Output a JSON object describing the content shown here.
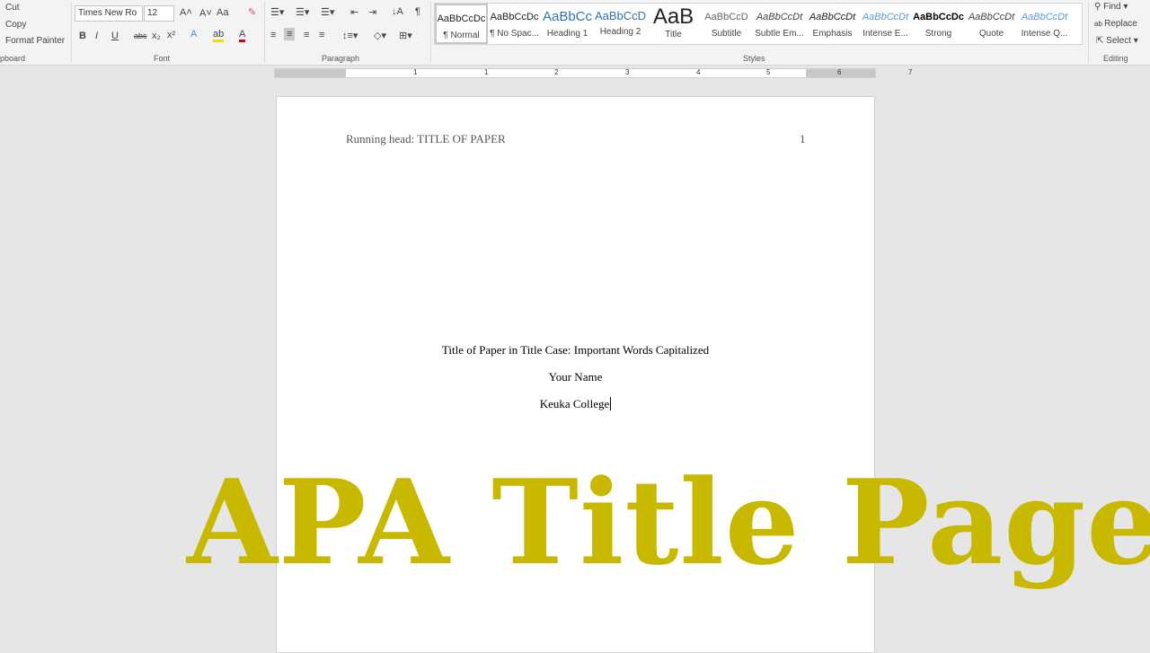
{
  "clipboard": {
    "cut": "Cut",
    "copy": "Copy",
    "format_painter": "Format Painter",
    "label": "pboard"
  },
  "font": {
    "name": "Times New Ro",
    "size": "12",
    "label": "Font",
    "bold": "B",
    "italic": "I",
    "underline": "U",
    "strike": "abc",
    "change_case": "Aa"
  },
  "paragraph": {
    "label": "Paragraph",
    "pilcrow": "¶"
  },
  "styles": {
    "label": "Styles",
    "items": [
      {
        "preview": "AaBbCcDc",
        "name": "¶ Normal",
        "color": "#222"
      },
      {
        "preview": "AaBbCcDc",
        "name": "¶ No Spac...",
        "color": "#222"
      },
      {
        "preview": "AaBbCc",
        "name": "Heading 1",
        "color": "#2e74b5"
      },
      {
        "preview": "AaBbCcD",
        "name": "Heading 2",
        "color": "#2e74b5"
      },
      {
        "preview": "AaB",
        "name": "Title",
        "color": "#222"
      },
      {
        "preview": "AaBbCcD",
        "name": "Subtitle",
        "color": "#666"
      },
      {
        "preview": "AaBbCcDt",
        "name": "Subtle Em...",
        "color": "#444"
      },
      {
        "preview": "AaBbCcDt",
        "name": "Emphasis",
        "color": "#222"
      },
      {
        "preview": "AaBbCcDt",
        "name": "Intense E...",
        "color": "#5b9bd5"
      },
      {
        "preview": "AaBbCcDc",
        "name": "Strong",
        "color": "#000"
      },
      {
        "preview": "AaBbCcDt",
        "name": "Quote",
        "color": "#444"
      },
      {
        "preview": "AaBbCcDt",
        "name": "Intense Q...",
        "color": "#5b9bd5"
      }
    ]
  },
  "editing": {
    "label": "Editing",
    "find": "Find",
    "replace": "Replace",
    "select": "Select"
  },
  "ruler": {
    "numbers": [
      "1",
      "1",
      "2",
      "3",
      "4",
      "5",
      "6",
      "7"
    ]
  },
  "document": {
    "running_head": "Running head: TITLE OF PAPER",
    "page_number": "1",
    "title": "Title of Paper in Title Case: Important Words Capitalized",
    "author": "Your Name",
    "institution": "Keuka College"
  },
  "overlay": {
    "text": "APA Title Page",
    "color": "#c9b800"
  }
}
